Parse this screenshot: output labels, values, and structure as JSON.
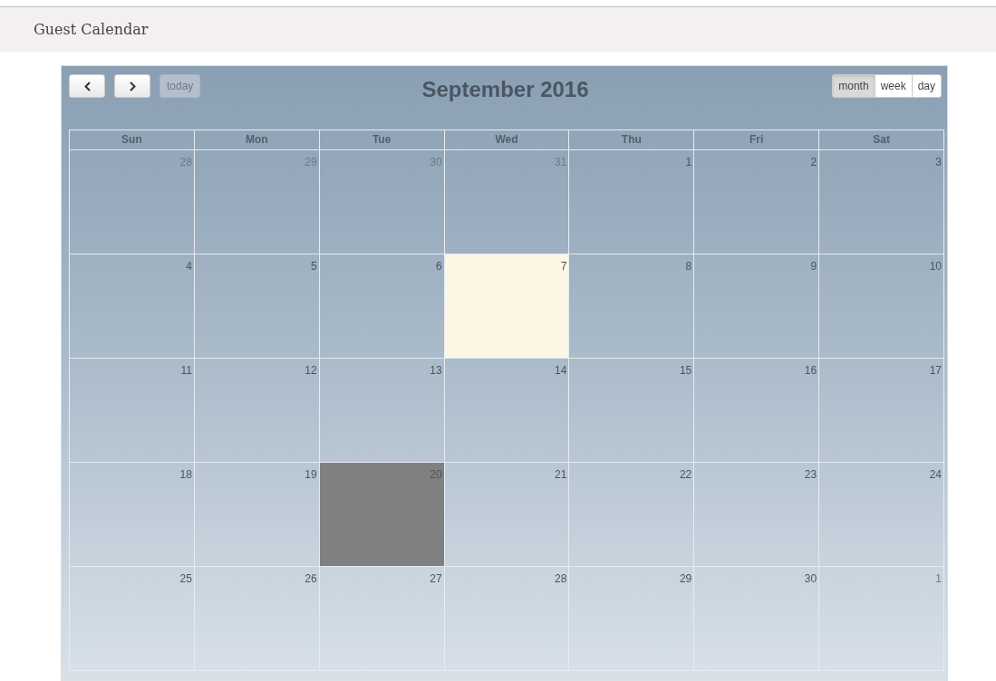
{
  "header": {
    "title": "Guest Calendar"
  },
  "toolbar": {
    "today": {
      "label": "today",
      "disabled": true
    },
    "title": "September 2016",
    "views": [
      {
        "label": "month",
        "selected": true
      },
      {
        "label": "week",
        "selected": false
      },
      {
        "label": "day",
        "selected": false
      }
    ]
  },
  "weekdays": [
    "Sun",
    "Mon",
    "Tue",
    "Wed",
    "Thu",
    "Fri",
    "Sat"
  ],
  "weeks": [
    [
      {
        "label": "28",
        "other_month": true,
        "today": false,
        "selected": false
      },
      {
        "label": "29",
        "other_month": true,
        "today": false,
        "selected": false
      },
      {
        "label": "30",
        "other_month": true,
        "today": false,
        "selected": false
      },
      {
        "label": "31",
        "other_month": true,
        "today": false,
        "selected": false
      },
      {
        "label": "1",
        "other_month": false,
        "today": false,
        "selected": false
      },
      {
        "label": "2",
        "other_month": false,
        "today": false,
        "selected": false
      },
      {
        "label": "3",
        "other_month": false,
        "today": false,
        "selected": false
      }
    ],
    [
      {
        "label": "4",
        "other_month": false,
        "today": false,
        "selected": false
      },
      {
        "label": "5",
        "other_month": false,
        "today": false,
        "selected": false
      },
      {
        "label": "6",
        "other_month": false,
        "today": false,
        "selected": false
      },
      {
        "label": "7",
        "other_month": false,
        "today": true,
        "selected": false
      },
      {
        "label": "8",
        "other_month": false,
        "today": false,
        "selected": false
      },
      {
        "label": "9",
        "other_month": false,
        "today": false,
        "selected": false
      },
      {
        "label": "10",
        "other_month": false,
        "today": false,
        "selected": false
      }
    ],
    [
      {
        "label": "11",
        "other_month": false,
        "today": false,
        "selected": false
      },
      {
        "label": "12",
        "other_month": false,
        "today": false,
        "selected": false
      },
      {
        "label": "13",
        "other_month": false,
        "today": false,
        "selected": false
      },
      {
        "label": "14",
        "other_month": false,
        "today": false,
        "selected": false
      },
      {
        "label": "15",
        "other_month": false,
        "today": false,
        "selected": false
      },
      {
        "label": "16",
        "other_month": false,
        "today": false,
        "selected": false
      },
      {
        "label": "17",
        "other_month": false,
        "today": false,
        "selected": false
      }
    ],
    [
      {
        "label": "18",
        "other_month": false,
        "today": false,
        "selected": false
      },
      {
        "label": "19",
        "other_month": false,
        "today": false,
        "selected": false
      },
      {
        "label": "20",
        "other_month": false,
        "today": false,
        "selected": true
      },
      {
        "label": "21",
        "other_month": false,
        "today": false,
        "selected": false
      },
      {
        "label": "22",
        "other_month": false,
        "today": false,
        "selected": false
      },
      {
        "label": "23",
        "other_month": false,
        "today": false,
        "selected": false
      },
      {
        "label": "24",
        "other_month": false,
        "today": false,
        "selected": false
      }
    ],
    [
      {
        "label": "25",
        "other_month": false,
        "today": false,
        "selected": false
      },
      {
        "label": "26",
        "other_month": false,
        "today": false,
        "selected": false
      },
      {
        "label": "27",
        "other_month": false,
        "today": false,
        "selected": false
      },
      {
        "label": "28",
        "other_month": false,
        "today": false,
        "selected": false
      },
      {
        "label": "29",
        "other_month": false,
        "today": false,
        "selected": false
      },
      {
        "label": "30",
        "other_month": false,
        "today": false,
        "selected": false
      },
      {
        "label": "1",
        "other_month": true,
        "today": false,
        "selected": false
      }
    ]
  ]
}
